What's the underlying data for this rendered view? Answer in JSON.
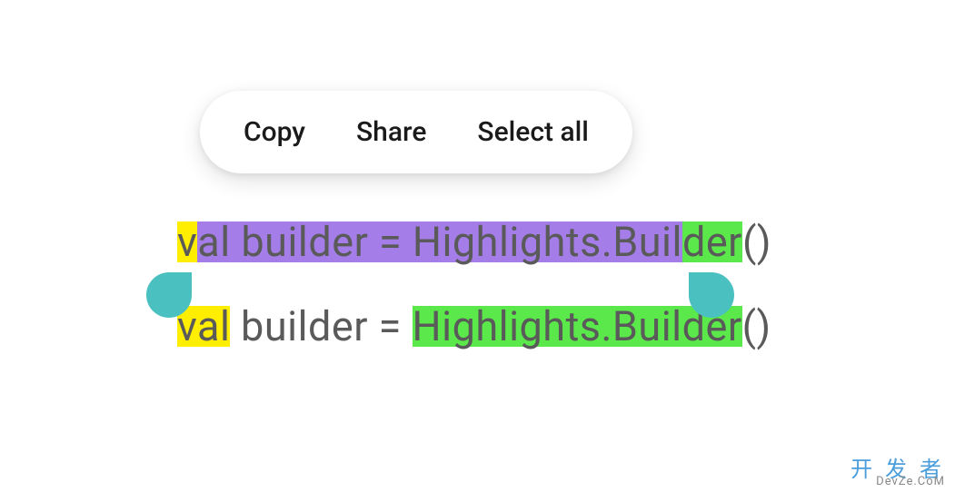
{
  "context_menu": {
    "copy_label": "Copy",
    "share_label": "Share",
    "select_all_label": "Select all"
  },
  "code": {
    "line1": {
      "seg_v": "v",
      "seg_al_builder_highlights_buil": "al builder = Highlights.Buil",
      "seg_der": "der",
      "seg_parens": "()"
    },
    "line2": {
      "seg_val": "val",
      "seg_builder_eq": " builder = ",
      "seg_highlights_dot": "Highlights.",
      "seg_builder": "Builder",
      "seg_parens": "()"
    }
  },
  "watermark": {
    "main": "开 发 者",
    "sub": "DevZe.CoM"
  }
}
